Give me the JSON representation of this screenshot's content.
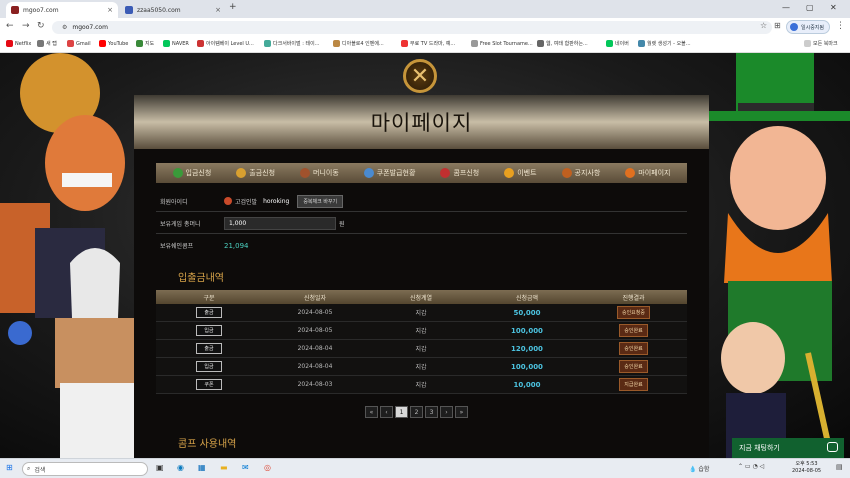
{
  "browser": {
    "tabs": [
      {
        "title": "mgoo7.com",
        "active": true
      },
      {
        "title": "zzaa5050.com",
        "active": false
      }
    ],
    "url": "mgoo7.com",
    "profile_label": "일시중지됨",
    "all_bookmarks": "모든 북마크",
    "bookmarks": [
      "Netflix",
      "새 탭",
      "Gmail",
      "YouTube",
      "지도",
      "NAVER",
      "아이템베이 Level U...",
      "다크서바이벌 : 테이...",
      "디아블로4 인벤에...",
      "무료 TV 드라마, 예...",
      "Free Slot Tourname...",
      "웹, 여태 합판하는...",
      "네이버",
      "월렛 생성기 - 오볼..."
    ]
  },
  "modal": {
    "title": "마이페이지",
    "close_icon": "X",
    "menu": [
      {
        "label": "입금신청",
        "icon": "money-bag-icon",
        "color": "#3a9a3a"
      },
      {
        "label": "출금신청",
        "icon": "coin-icon",
        "color": "#d8a030"
      },
      {
        "label": "머니이동",
        "icon": "chest-icon",
        "color": "#a0522d"
      },
      {
        "label": "쿠폰발급현황",
        "icon": "coupon-icon",
        "color": "#4a8ad0"
      },
      {
        "label": "콤프신청",
        "icon": "apple-icon",
        "color": "#c03030"
      },
      {
        "label": "이벤트",
        "icon": "star-icon",
        "color": "#e8a020"
      },
      {
        "label": "공지사항",
        "icon": "megaphone-icon",
        "color": "#c06020"
      },
      {
        "label": "마이페이지",
        "icon": "user-icon",
        "color": "#e07020"
      }
    ],
    "member_id_label": "회원아이디",
    "level_label": "고검인발",
    "user_id": "horoking",
    "dup_check_label": "중복체크 바꾸기",
    "balance_label": "보유게임 총머니",
    "balance_value": "1,000",
    "balance_unit": "원",
    "comp_label": "보유쉐인콤프",
    "comp_value": "21,094",
    "history_title": "입출금내역",
    "columns": [
      "구분",
      "신청일자",
      "신청계열",
      "신청금액",
      "진행결과"
    ],
    "rows": [
      {
        "type": "출금",
        "date": "2024-08-05",
        "method": "지갑",
        "amount": "50,000",
        "status": "승인요청중"
      },
      {
        "type": "입금",
        "date": "2024-08-05",
        "method": "지갑",
        "amount": "100,000",
        "status": "승인완료"
      },
      {
        "type": "출금",
        "date": "2024-08-04",
        "method": "지갑",
        "amount": "120,000",
        "status": "승인완료"
      },
      {
        "type": "입금",
        "date": "2024-08-04",
        "method": "지갑",
        "amount": "100,000",
        "status": "승인완료"
      },
      {
        "type": "쿠폰",
        "date": "2024-08-03",
        "method": "지갑",
        "amount": "10,000",
        "status": "지급완료"
      }
    ],
    "pager": {
      "first": "«",
      "prev": "‹",
      "pages": [
        "1",
        "2",
        "3"
      ],
      "current": "1",
      "next": "›",
      "last": "»"
    },
    "comp_history_title": "콤프 사용내역"
  },
  "chat": {
    "label": "지금 채팅하기"
  },
  "taskbar": {
    "search_placeholder": "검색",
    "weather": "습함",
    "time": "오후 5:53",
    "date": "2024-08-05"
  }
}
